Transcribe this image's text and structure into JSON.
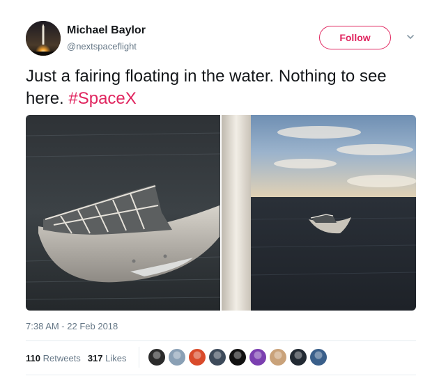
{
  "author": {
    "display_name": "Michael Baylor",
    "handle": "@nextspaceflight",
    "avatar_icon": "rocket-launch-avatar"
  },
  "follow_button": {
    "label": "Follow",
    "color": "#e0245e"
  },
  "caret_icon": "chevron-down-icon",
  "tweet": {
    "text": "Just a fairing floating in the water. Nothing to see here. ",
    "hashtag": "#SpaceX"
  },
  "media": {
    "count": 2
  },
  "timestamp": "7:38 AM - 22 Feb 2018",
  "stats": {
    "retweets_count": "110",
    "retweets_label": "Retweets",
    "likes_count": "317",
    "likes_label": "Likes"
  },
  "likers": [
    {
      "icon": "liker-avatar-1",
      "color": "#2b2b2b"
    },
    {
      "icon": "liker-avatar-2",
      "color": "#8aa0b5"
    },
    {
      "icon": "liker-avatar-3",
      "color": "#d94b2b"
    },
    {
      "icon": "liker-avatar-4",
      "color": "#3d4a5a"
    },
    {
      "icon": "liker-avatar-5",
      "color": "#111111"
    },
    {
      "icon": "liker-avatar-6",
      "color": "#7b3fb0"
    },
    {
      "icon": "liker-avatar-7",
      "color": "#c9a27a"
    },
    {
      "icon": "liker-avatar-8",
      "color": "#222a33"
    },
    {
      "icon": "liker-avatar-9",
      "color": "#3a5f8a"
    }
  ],
  "colors": {
    "text": "#14171a",
    "secondary": "#657786",
    "accent": "#e0245e",
    "divider": "#e6ecf0"
  }
}
